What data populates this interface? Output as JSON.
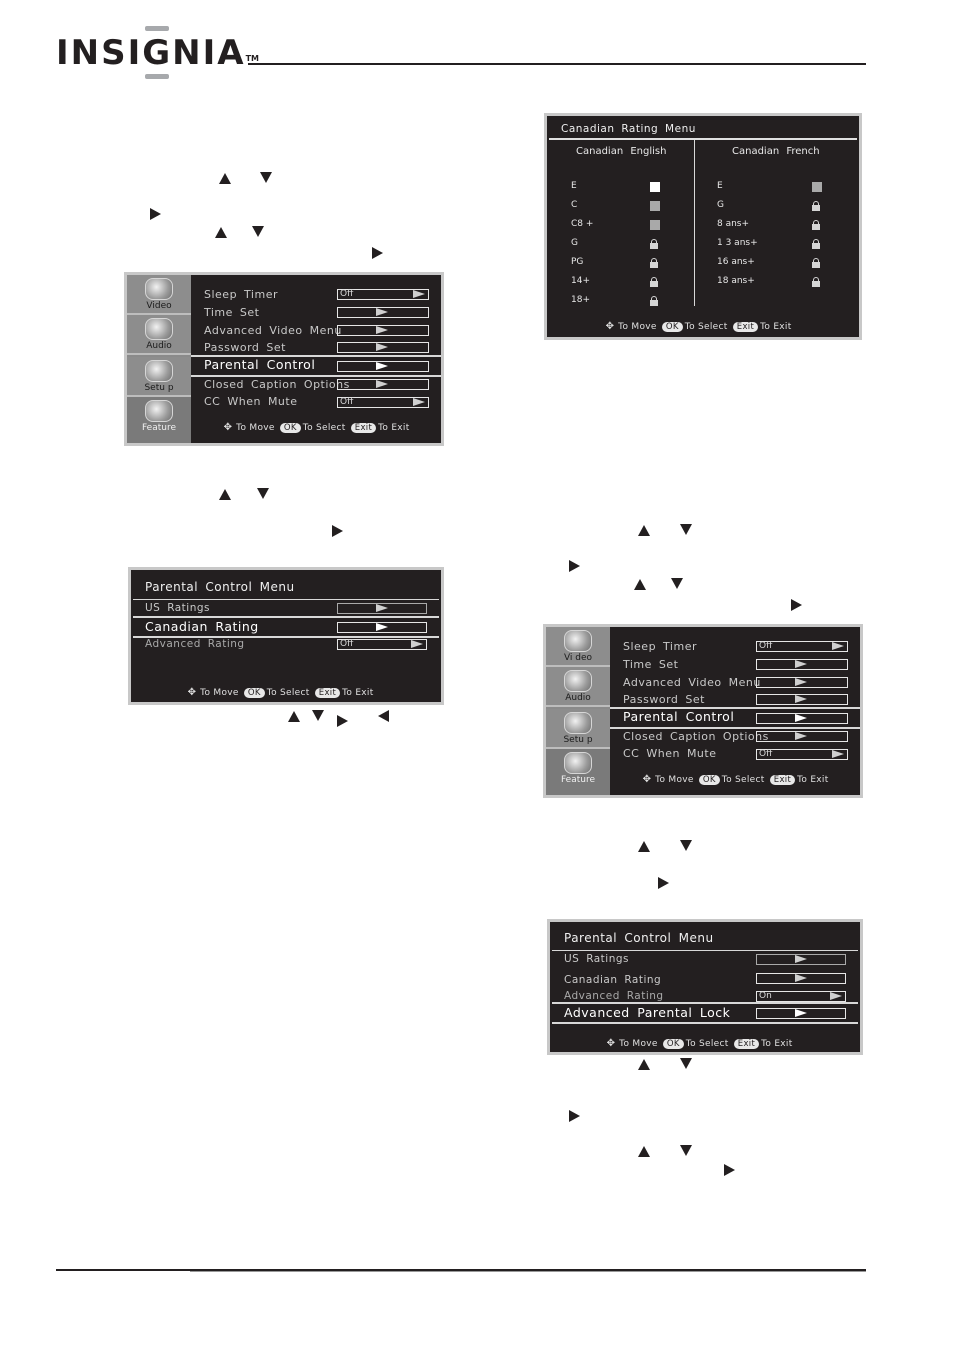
{
  "header": {
    "brand": "INSIGNIA",
    "trademark": "TM"
  },
  "hint_bar": {
    "move_icon": "four-way-arrow-icon",
    "move": "To Move",
    "ok": "OK",
    "select": "To Select",
    "exit_btn": "Exit",
    "exit": "To Exit"
  },
  "setup_menu_1": {
    "sidebar": [
      {
        "label": "Video",
        "icon": "video-icon"
      },
      {
        "label": "Audio",
        "icon": "speaker-icon"
      },
      {
        "label": "Setu p",
        "icon": "setup-globe-icon"
      },
      {
        "label": "Feature",
        "icon": "feature-icon"
      }
    ],
    "items": [
      {
        "label": "Sleep Timer",
        "value": "Off"
      },
      {
        "label": "Time Set",
        "value": ""
      },
      {
        "label": "Advanced Video Menu",
        "value": ""
      },
      {
        "label": "Password Set",
        "value": ""
      },
      {
        "label": "Parental Control",
        "value": "",
        "selected": true
      },
      {
        "label": "Closed Caption Options",
        "value": ""
      },
      {
        "label": "CC When Mute",
        "value": "Off"
      }
    ]
  },
  "parental_menu_1": {
    "title": "Parental Control Menu",
    "items": [
      {
        "label": "US Ratings",
        "value": ""
      },
      {
        "label": "Canadian Rating",
        "value": "",
        "selected": true
      },
      {
        "label": "Advanced Rating",
        "value": "Off"
      }
    ]
  },
  "canadian_menu": {
    "title": "Canadian Rating Menu",
    "english": {
      "heading": "Canadian English",
      "ratings": [
        {
          "label": "E",
          "state": "unlocked-white"
        },
        {
          "label": "C",
          "state": "unlocked-grey"
        },
        {
          "label": "C8 +",
          "state": "unlocked-grey"
        },
        {
          "label": "G",
          "state": "locked"
        },
        {
          "label": "PG",
          "state": "locked"
        },
        {
          "label": "14+",
          "state": "locked"
        },
        {
          "label": "18+",
          "state": "locked"
        }
      ]
    },
    "french": {
      "heading": "Canadian French",
      "ratings": [
        {
          "label": "E",
          "state": "unlocked-grey"
        },
        {
          "label": "G",
          "state": "locked"
        },
        {
          "label": "8 ans+",
          "state": "locked"
        },
        {
          "label": "1 3 ans+",
          "state": "locked"
        },
        {
          "label": "16 ans+",
          "state": "locked"
        },
        {
          "label": "18 ans+",
          "state": "locked"
        }
      ]
    }
  },
  "setup_menu_2": {
    "sidebar": [
      {
        "label": "Vi deo"
      },
      {
        "label": "Audio"
      },
      {
        "label": "Setu p"
      },
      {
        "label": "Feature"
      }
    ],
    "items": [
      {
        "label": "Sleep Timer",
        "value": "Off"
      },
      {
        "label": "Time Set",
        "value": ""
      },
      {
        "label": "Advanced Video Menu",
        "value": ""
      },
      {
        "label": "Password Set",
        "value": ""
      },
      {
        "label": "Parental Control",
        "value": "",
        "selected": true
      },
      {
        "label": "Closed Caption Options",
        "value": ""
      },
      {
        "label": "CC When Mute",
        "value": "Off"
      }
    ]
  },
  "parental_menu_2": {
    "title": "Parental Control Menu",
    "items": [
      {
        "label": "US Ratings",
        "value": ""
      },
      {
        "label": "Canadian Rating",
        "value": ""
      },
      {
        "label": "Advanced Rating",
        "value": "On"
      },
      {
        "label": "Advanced Parental Lock",
        "value": "",
        "selected": true
      }
    ]
  },
  "inline_glyphs": [
    "up-arrow",
    "down-arrow",
    "right-arrow",
    "left-arrow"
  ]
}
